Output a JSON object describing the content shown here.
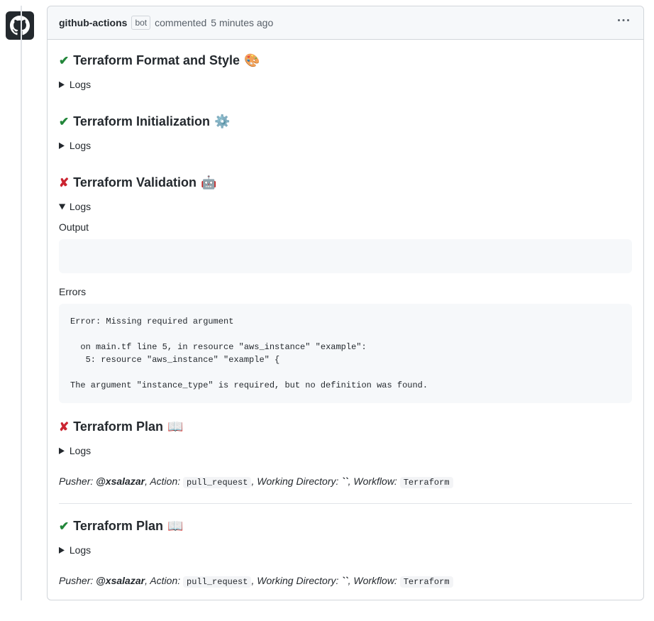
{
  "header": {
    "author": "github-actions",
    "bot_label": "bot",
    "action_text": "commented",
    "timestamp": "5 minutes ago"
  },
  "logs_label": "Logs",
  "sections": {
    "format": {
      "title": "Terraform Format and Style",
      "emoji": "🎨"
    },
    "init": {
      "title": "Terraform Initialization",
      "emoji": "⚙️"
    },
    "validate": {
      "title": "Terraform Validation",
      "emoji": "🤖",
      "output_label": "Output",
      "errors_label": "Errors",
      "output_content": "",
      "errors_content": "Error: Missing required argument\n\n  on main.tf line 5, in resource \"aws_instance\" \"example\":\n   5: resource \"aws_instance\" \"example\" {\n\nThe argument \"instance_type\" is required, but no definition was found."
    },
    "plan1": {
      "title": "Terraform Plan",
      "emoji": "📖"
    },
    "plan2": {
      "title": "Terraform Plan",
      "emoji": "📖"
    }
  },
  "footer": {
    "pusher_label": "Pusher:",
    "pusher_value": "@xsalazar",
    "action_label": "Action:",
    "action_value": "pull_request",
    "workdir_label": "Working Directory:",
    "workdir_value": "``",
    "workflow_label": "Workflow:",
    "workflow_value": "Terraform"
  }
}
